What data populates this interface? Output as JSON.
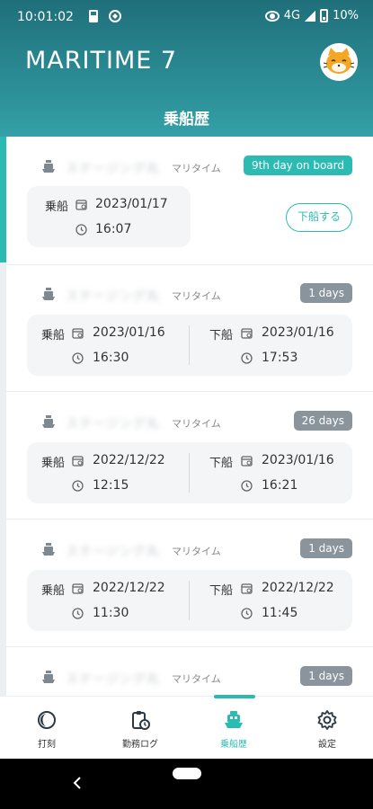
{
  "status_bar": {
    "time": "10:01:02",
    "network": "4G",
    "battery": "10%"
  },
  "header": {
    "app_title": "MARITIME 7",
    "page_title": "乗船歴"
  },
  "records": [
    {
      "ship_name": "ステージング丸",
      "company": "マリタイム",
      "badge": "9th day on board",
      "badge_color": "#2bbbb3",
      "embark_label": "乗船",
      "embark_date": "2023/01/17",
      "embark_time": "16:07",
      "disembark_button": "下船する",
      "active": true
    },
    {
      "ship_name": "ステージング丸",
      "company": "マリタイム",
      "badge": "1 days",
      "badge_color": "#8a949c",
      "embark_label": "乗船",
      "embark_date": "2023/01/16",
      "embark_time": "16:30",
      "disembark_label": "下船",
      "disembark_date": "2023/01/16",
      "disembark_time": "17:53"
    },
    {
      "ship_name": "ステージング丸",
      "company": "マリタイム",
      "badge": "26 days",
      "badge_color": "#8a949c",
      "embark_label": "乗船",
      "embark_date": "2022/12/22",
      "embark_time": "12:15",
      "disembark_label": "下船",
      "disembark_date": "2023/01/16",
      "disembark_time": "16:21"
    },
    {
      "ship_name": "ステージング丸",
      "company": "マリタイム",
      "badge": "1 days",
      "badge_color": "#8a949c",
      "embark_label": "乗船",
      "embark_date": "2022/12/22",
      "embark_time": "11:30",
      "disembark_label": "下船",
      "disembark_date": "2022/12/22",
      "disembark_time": "11:45"
    },
    {
      "ship_name": "ステージング丸",
      "company": "マリタイム",
      "badge": "1 days",
      "badge_color": "#8a949c"
    }
  ],
  "bottom_nav": [
    {
      "label": "打刻",
      "icon": "clock-moon-icon"
    },
    {
      "label": "勤務ログ",
      "icon": "clipboard-clock-icon"
    },
    {
      "label": "乗船歴",
      "icon": "ship-icon",
      "active": true
    },
    {
      "label": "設定",
      "icon": "gear-icon"
    }
  ],
  "colors": {
    "accent": "#2bbbb3",
    "header": "#2a8a93",
    "badge_gray": "#8a949c"
  }
}
